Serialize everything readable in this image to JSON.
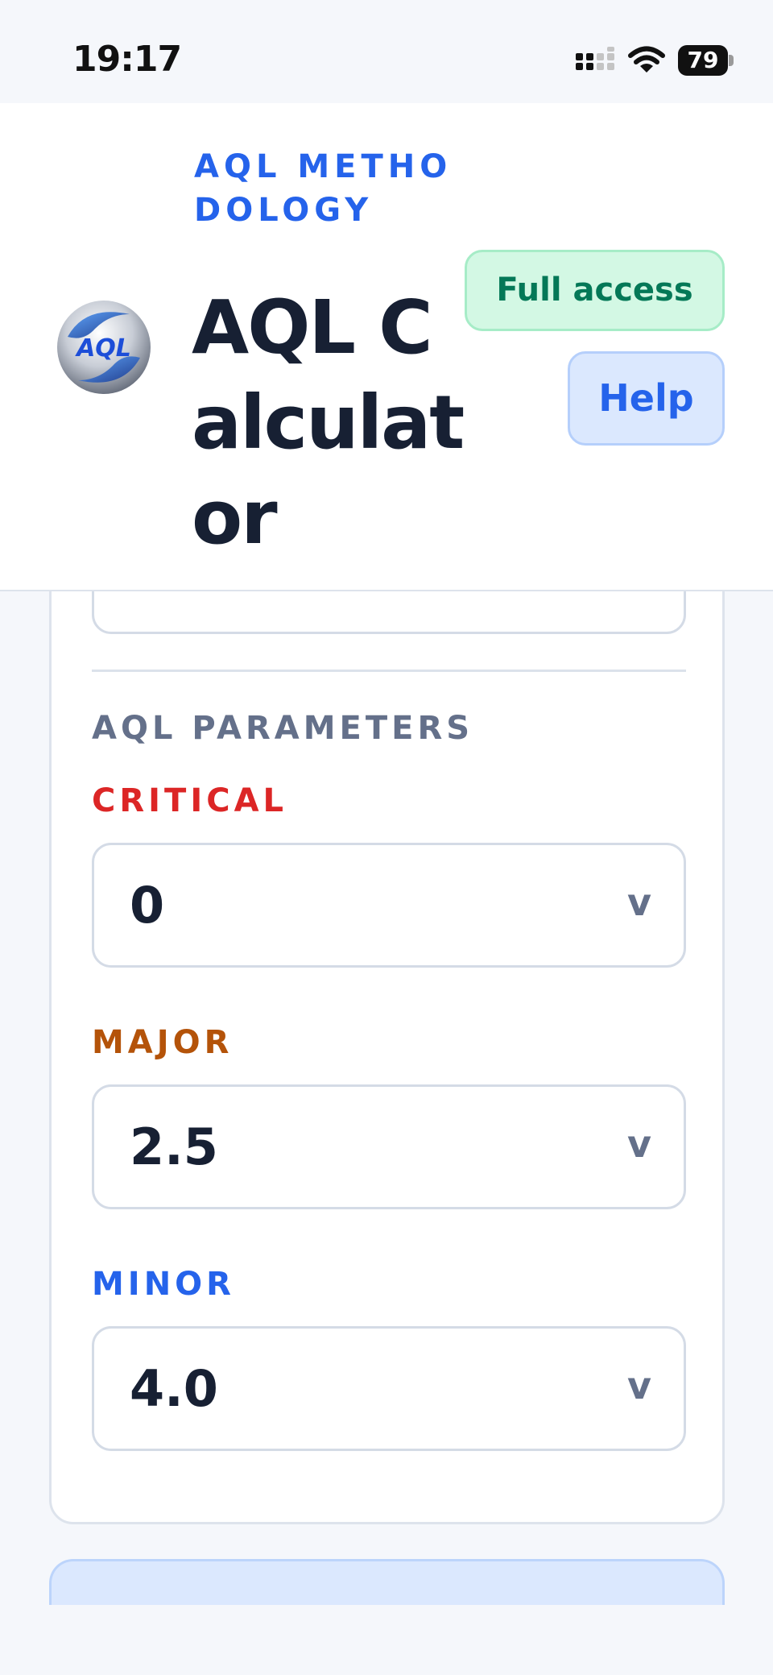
{
  "status_bar": {
    "time": "19:17",
    "battery_level": "79",
    "icons": [
      "signal-icon",
      "wifi-icon",
      "battery-icon"
    ]
  },
  "header": {
    "eyebrow": "AQL METHODOLOGY",
    "title": "AQL Calculator",
    "logo_text": "AQL",
    "access_badge": "Full access",
    "help_label": "Help"
  },
  "aql_parameters": {
    "heading": "AQL PARAMETERS",
    "fields": [
      {
        "label": "CRITICAL",
        "value": "0",
        "caret": "v"
      },
      {
        "label": "MAJOR",
        "value": "2.5",
        "caret": "v"
      },
      {
        "label": "MINOR",
        "value": "4.0",
        "caret": "v"
      }
    ]
  },
  "colors": {
    "accent_blue": "#2563eb",
    "critical_red": "#dc2626",
    "major_orange": "#b45309",
    "badge_green": "#047857",
    "muted": "#64708a"
  }
}
